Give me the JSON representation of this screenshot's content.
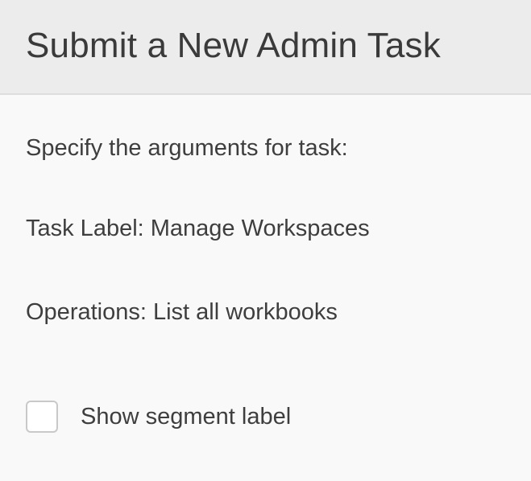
{
  "dialog": {
    "title": "Submit a New Admin Task",
    "intro": "Specify the arguments for task:",
    "task_label_line": "Task Label: Manage Workspaces",
    "operations_line": "Operations: List all workbooks",
    "checkbox": {
      "label": "Show segment label",
      "checked": false
    }
  },
  "colors": {
    "header_bg": "#ececec",
    "body_bg": "#f9f9f9",
    "text": "#3e3e3e",
    "checkbox_border": "#c9c9c9"
  }
}
